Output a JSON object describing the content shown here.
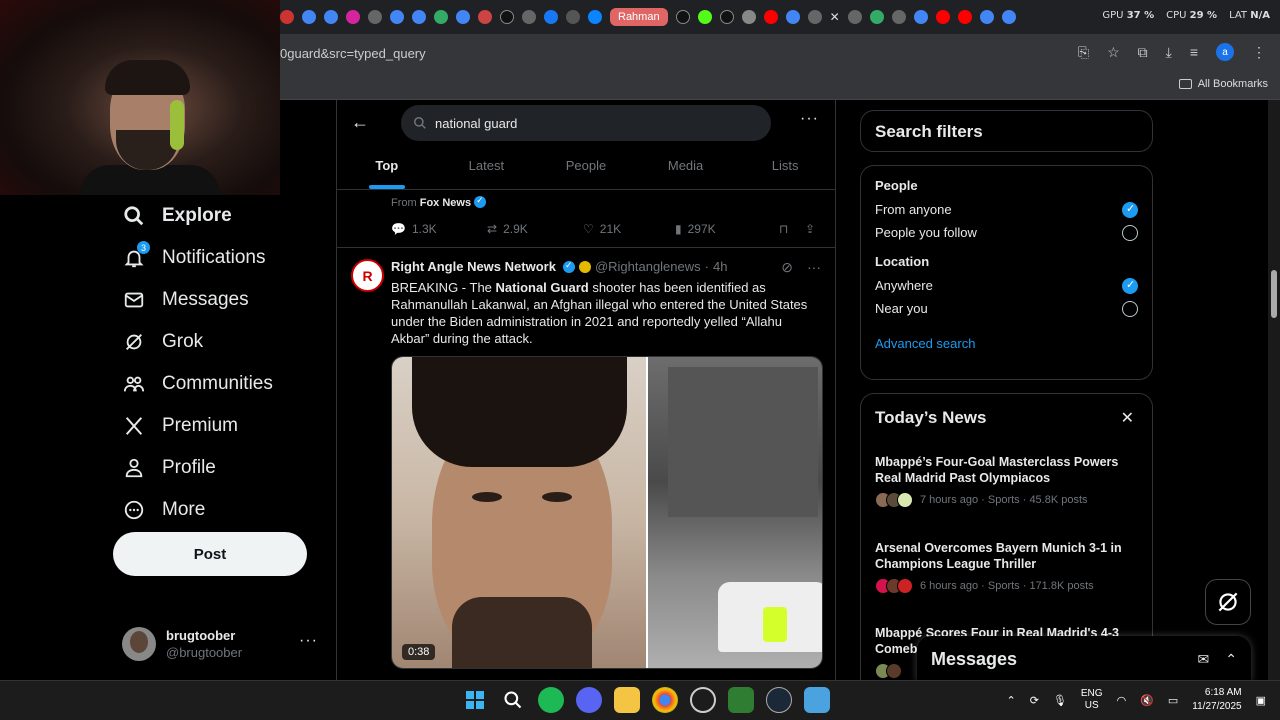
{
  "browser": {
    "active_tab_label": "Rahman",
    "url_fragment": "0guard&src=typed_query",
    "all_bookmarks": "All Bookmarks",
    "profile_letter": "a",
    "sysmon": {
      "gpu_label": "GPU",
      "gpu_value": "37 %",
      "cpu_label": "CPU",
      "cpu_value": "29 %",
      "lat_label": "LAT",
      "lat_value": "N/A"
    }
  },
  "nav": {
    "items": [
      {
        "label": "Explore",
        "icon": "search-icon"
      },
      {
        "label": "Notifications",
        "icon": "bell-icon",
        "badge": "3"
      },
      {
        "label": "Messages",
        "icon": "envelope-icon"
      },
      {
        "label": "Grok",
        "icon": "grok-icon"
      },
      {
        "label": "Communities",
        "icon": "people-icon"
      },
      {
        "label": "Premium",
        "icon": "x-logo-icon"
      },
      {
        "label": "Profile",
        "icon": "person-icon"
      },
      {
        "label": "More",
        "icon": "more-circle-icon"
      }
    ],
    "post_label": "Post",
    "account": {
      "name": "brugtoober",
      "handle": "@brugtoober"
    }
  },
  "search": {
    "query": "national guard",
    "tabs": [
      "Top",
      "Latest",
      "People",
      "Media",
      "Lists"
    ],
    "active_tab": "Top"
  },
  "prev_tweet": {
    "from_prefix": "From",
    "from_source": "Fox News",
    "replies": "1.3K",
    "reposts": "2.9K",
    "likes": "21K",
    "views": "297K"
  },
  "tweet": {
    "avatar_text": "R",
    "author": "Right Angle News Network",
    "handle": "@Rightanglenews",
    "dot": "·",
    "time": "4h",
    "text_pre": "BREAKING - The ",
    "text_bold": "National Guard",
    "text_post": " shooter has been identified as Rahmanullah Lakanwal, an Afghan illegal who entered the United States under the Biden administration in 2021 and reportedly yelled “Allahu Akbar” during the attack.",
    "video_duration": "0:38"
  },
  "filters": {
    "title": "Search filters",
    "people_label": "People",
    "people_options": [
      {
        "label": "From anyone",
        "selected": true
      },
      {
        "label": "People you follow",
        "selected": false
      }
    ],
    "location_label": "Location",
    "location_options": [
      {
        "label": "Anywhere",
        "selected": true
      },
      {
        "label": "Near you",
        "selected": false
      }
    ],
    "advanced": "Advanced search"
  },
  "news": {
    "title": "Today’s News",
    "items": [
      {
        "headline": "Mbappé’s Four-Goal Masterclass Powers Real Madrid Past Olympiacos",
        "meta": "7 hours ago · Sports · 45.8K posts"
      },
      {
        "headline": "Arsenal Overcomes Bayern Munich 3-1 in Champions League Thriller",
        "meta": "6 hours ago · Sports · 171.8K posts"
      },
      {
        "headline": "Mbappé Scores Four in Real Madrid's 4-3 Comeb",
        "meta": ""
      }
    ]
  },
  "messages_drawer": {
    "title": "Messages"
  },
  "taskbar": {
    "lang_top": "ENG",
    "lang_bottom": "US",
    "time": "6:18 AM",
    "date": "11/27/2025"
  },
  "colors": {
    "accent": "#1d9bf0",
    "background": "#000000",
    "text": "#e7e9ea",
    "muted": "#71767b"
  }
}
